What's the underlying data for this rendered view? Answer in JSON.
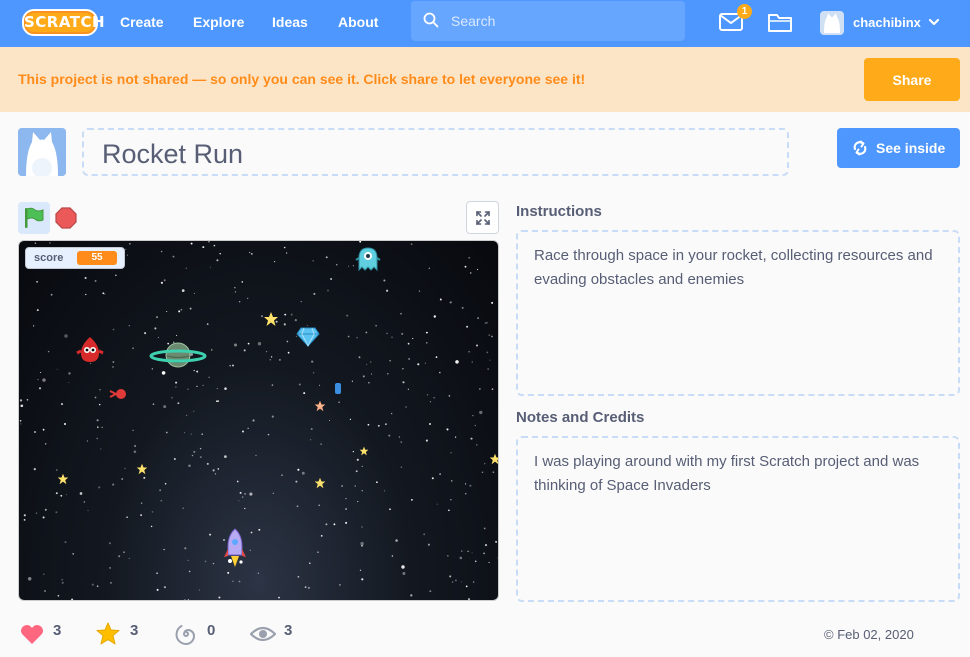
{
  "nav": {
    "logo": "SCRATCH",
    "links": [
      "Create",
      "Explore",
      "Ideas",
      "About"
    ],
    "search_placeholder": "Search",
    "messages_count": "1",
    "username": "chachibinx"
  },
  "banner": {
    "text": "This project is not shared — so only you can see it. Click share to let everyone see it!",
    "share_label": "Share"
  },
  "project": {
    "title": "Rocket Run",
    "see_inside_label": "See inside"
  },
  "stage": {
    "monitor_label": "score",
    "monitor_value": "55"
  },
  "instructions": {
    "heading": "Instructions",
    "text": "Race through space in your rocket, collecting resources and evading obstacles and enemies"
  },
  "notes": {
    "heading": "Notes and Credits",
    "text": "I was playing around with my first Scratch project and was thinking of Space Invaders"
  },
  "stats": {
    "loves": "3",
    "favorites": "3",
    "remixes": "0",
    "views": "3"
  },
  "date": "© Feb 02, 2020",
  "colors": {
    "nav_blue": "#4d97ff",
    "banner_bg": "#fce5c7",
    "banner_text": "#ff8c1a",
    "share_orange": "#ffab19",
    "text_gray": "#575e75"
  }
}
